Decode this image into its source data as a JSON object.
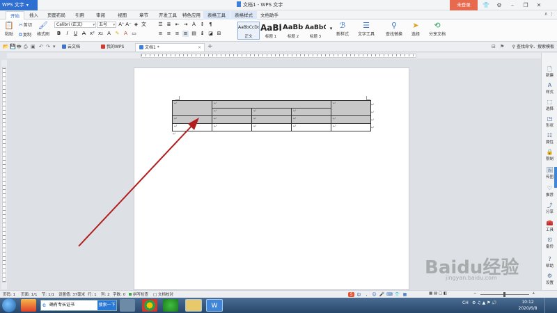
{
  "titlebar": {
    "app_name": "WPS 文字",
    "window_title": "文档1 - WPS 文字",
    "login_label": "未登录"
  },
  "menu_tabs": [
    {
      "label": "开始",
      "active": true
    },
    {
      "label": "插入"
    },
    {
      "label": "页面布局"
    },
    {
      "label": "引用"
    },
    {
      "label": "审阅"
    },
    {
      "label": "视图"
    },
    {
      "label": "章节"
    },
    {
      "label": "开发工具"
    },
    {
      "label": "特色应用"
    },
    {
      "label": "表格工具",
      "contextual": true
    },
    {
      "label": "表格样式",
      "contextual": true
    },
    {
      "label": "文档助手"
    }
  ],
  "ribbon": {
    "paste": "粘贴",
    "cut": "剪切",
    "copy": "复制",
    "format_painter": "格式刷",
    "font_name": "Calibri (正文)",
    "font_size": "五号",
    "styles": [
      {
        "preview": "AaBbCcDd",
        "name": "正文",
        "selected": true
      },
      {
        "preview": "AaBb",
        "name": "标题 1"
      },
      {
        "preview": "AaBbC",
        "name": "标题 2"
      },
      {
        "preview": "AaBbC",
        "name": "标题 3"
      }
    ],
    "new_style": "新样式",
    "text_tools": "文字工具",
    "find_replace": "查找替换",
    "select": "选择",
    "share_doc": "分享文档"
  },
  "tabbar": {
    "tabs": [
      {
        "label": "云文档",
        "color": "#3b74c9"
      },
      {
        "label": "我的WPS",
        "color": "#d23a2e"
      },
      {
        "label": "文档1 *",
        "color": "#3f7fd9",
        "active": true
      }
    ],
    "new_tab": "+",
    "search_cmd": "查找命令、搜索模板"
  },
  "table": {
    "para_mark": "↵"
  },
  "right_sidebar": [
    {
      "label": "新建",
      "icon": "new-icon"
    },
    {
      "label": "样式",
      "icon": "style-icon"
    },
    {
      "label": "选择",
      "icon": "select-icon"
    },
    {
      "label": "形状",
      "icon": "shape-icon"
    },
    {
      "label": "属性",
      "icon": "property-icon"
    },
    {
      "label": "限制",
      "icon": "restrict-icon"
    },
    {
      "label": "传图",
      "icon": "upload-image-icon"
    },
    {
      "label": "推荐",
      "icon": "recommend-icon"
    },
    {
      "label": "分享",
      "icon": "share-icon"
    },
    {
      "label": "工具",
      "icon": "tools-icon"
    },
    {
      "label": "备份",
      "icon": "backup-icon"
    },
    {
      "label": "帮助",
      "icon": "help-icon"
    },
    {
      "label": "设置",
      "icon": "settings-icon"
    }
  ],
  "statusbar": {
    "page_num": "页码: 1",
    "pages": "页面: 1/1",
    "section": "节: 1/1",
    "position": "设置值: 37毫米",
    "row": "行: 1",
    "column": "列: 2",
    "words": "字数: 0",
    "spell_check": "拼写检查",
    "doc_proof": "文档校对"
  },
  "taskbar": {
    "search_value": "确有专长证书",
    "search_btn": "搜索一下",
    "ime_lang": "CH",
    "time": "10:12",
    "date": "2020/6/8"
  },
  "ime": {
    "logo": "S",
    "mode": "中"
  },
  "watermark": {
    "text": "Baidu经验",
    "sub": "jingyan.baidu.com"
  },
  "colors": {
    "accent": "#2f6fd1",
    "login": "#e76a4f",
    "arrow": "#b01e1e",
    "table_shade": "#c8c8c8"
  }
}
